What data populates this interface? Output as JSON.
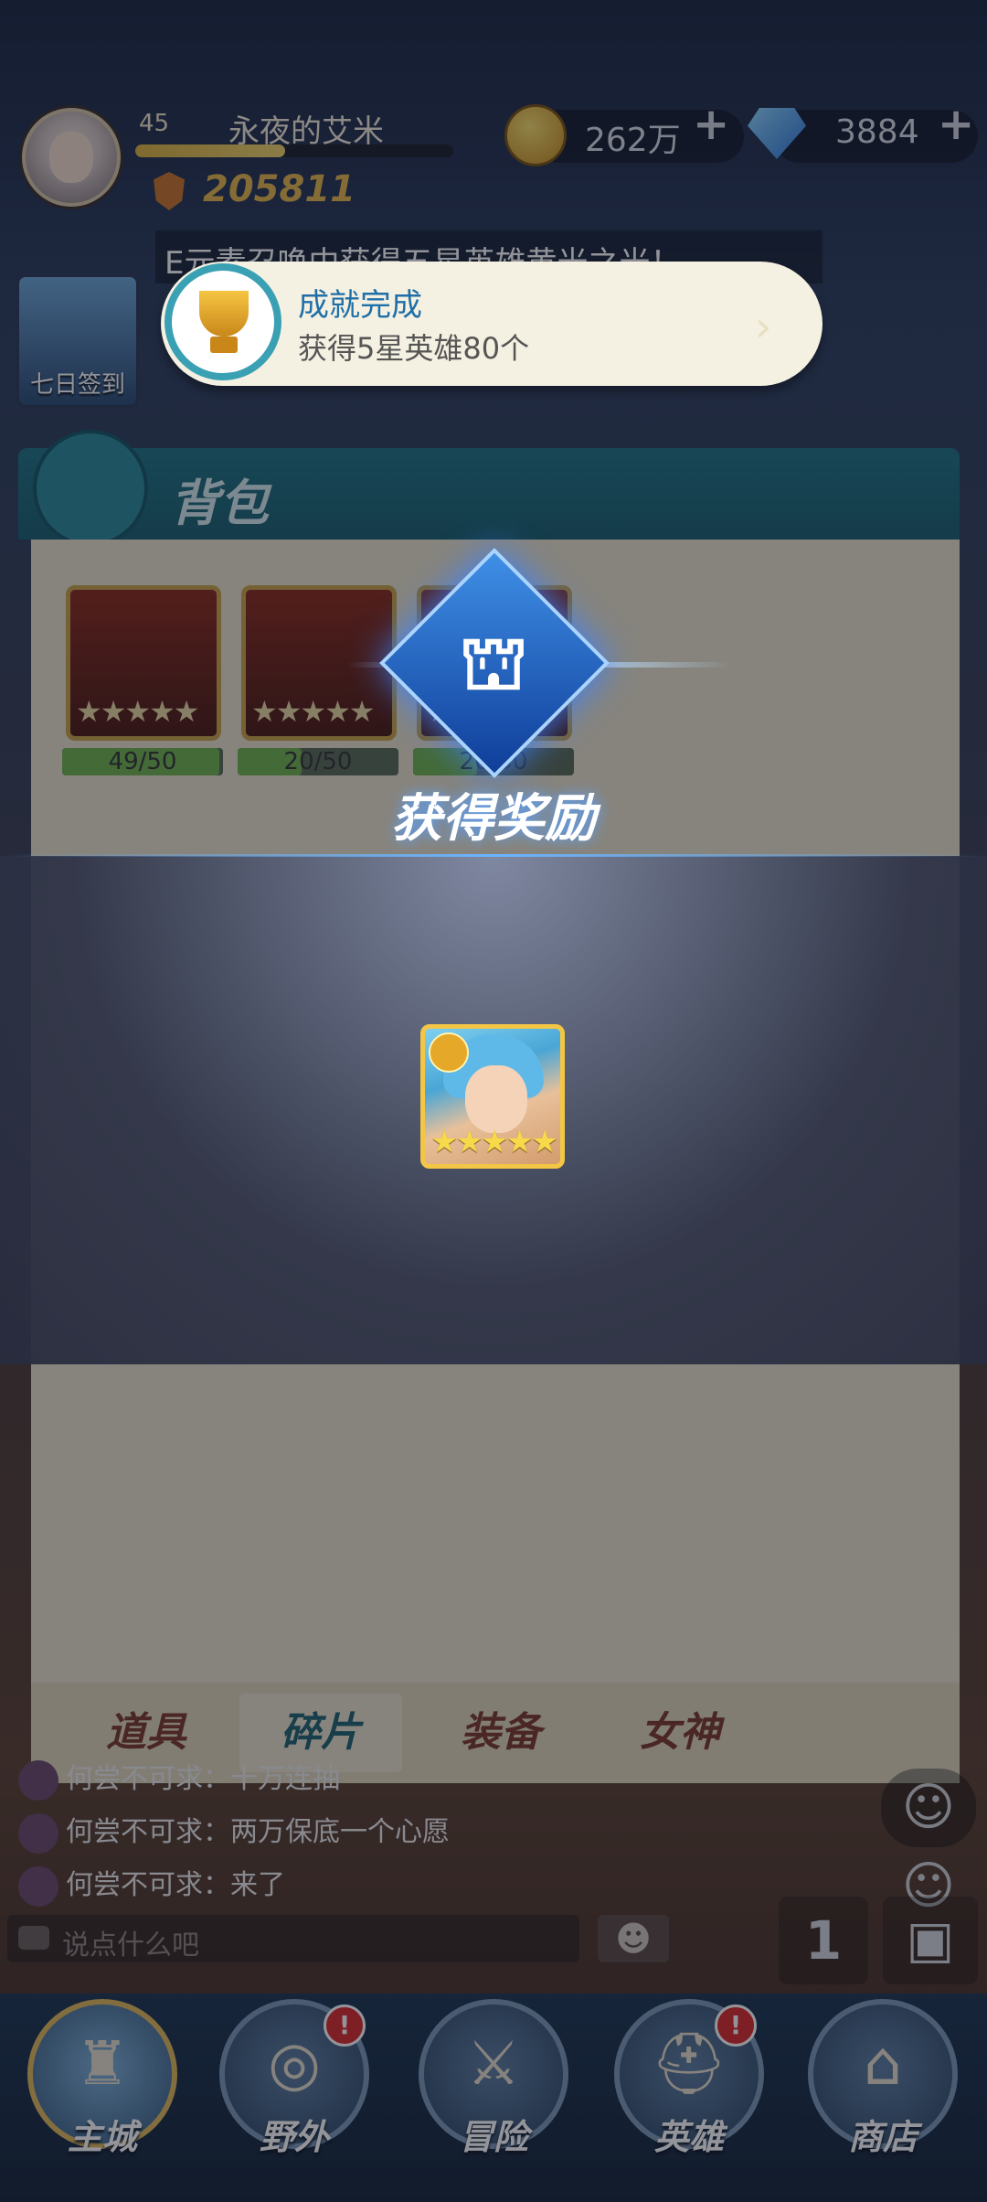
{
  "player": {
    "level": "45",
    "name": "永夜的艾米",
    "xp_fraction": 0.47,
    "power": "205811"
  },
  "resources": {
    "gold": "262万",
    "gold_add": "+",
    "gems": "3884",
    "gems_add": "+"
  },
  "broadcast": {
    "text": "E元素召唤中获得五星英雄黄光之光！"
  },
  "side": {
    "sign_in_label": "七日签到"
  },
  "toast": {
    "title": "成就完成",
    "subtitle": "获得5星英雄80个",
    "arrow": "›"
  },
  "panel": {
    "title": "背包",
    "items": [
      {
        "stars": "★★★★★",
        "progress_text": "49/50",
        "progress": 0.98
      },
      {
        "stars": "★★★★★",
        "progress_text": "20/50",
        "progress": 0.4
      },
      {
        "stars": "★★★★★",
        "progress_text": "20/50",
        "progress": 0.4
      }
    ],
    "tabs": [
      "道具",
      "碎片",
      "装备",
      "女神"
    ],
    "active_tab": "碎片"
  },
  "reward": {
    "title": "获得奖励",
    "hero_stars": "★★★★★"
  },
  "chat": {
    "lines": [
      "何尝不可求：十万连抽",
      "何尝不可求：两万保底一个心愿",
      "何尝不可求：来了"
    ],
    "input_placeholder": "说点什么吧",
    "emoji": "☻"
  },
  "nav": {
    "items": [
      {
        "label": "主城",
        "icon": "castle-icon",
        "alert": false
      },
      {
        "label": "野外",
        "icon": "portal-icon",
        "alert": true
      },
      {
        "label": "冒险",
        "icon": "sword-icon",
        "alert": false
      },
      {
        "label": "英雄",
        "icon": "helmet-icon",
        "alert": true
      },
      {
        "label": "商店",
        "icon": "shop-icon",
        "alert": false
      }
    ],
    "alert_mark": "!"
  },
  "colors": {
    "accent_teal": "#1f7383",
    "gold": "#e6b64a",
    "alert_red": "#d92a2a"
  }
}
